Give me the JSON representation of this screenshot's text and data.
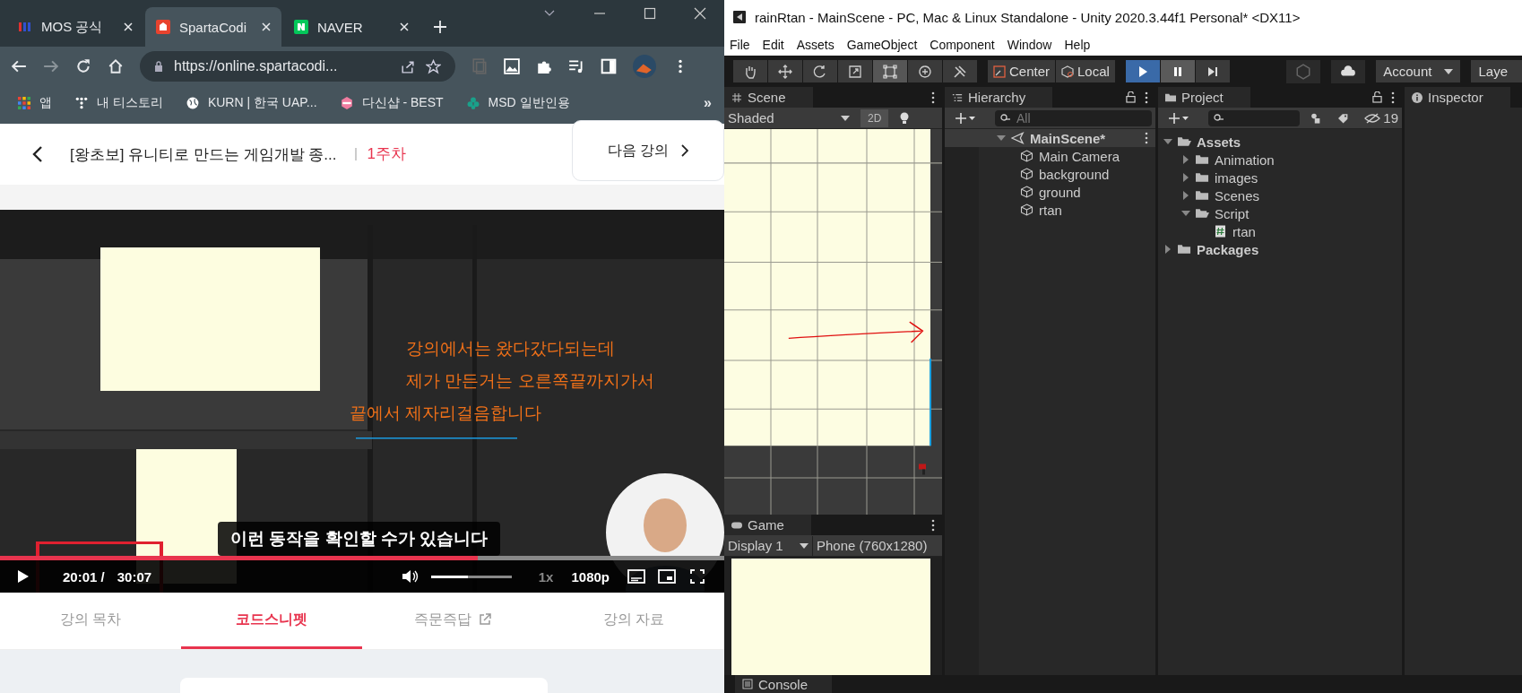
{
  "browser": {
    "tabs": [
      {
        "label": "MOS 공식",
        "selected": false
      },
      {
        "label": "SpartaCodi",
        "selected": true
      },
      {
        "label": "NAVER",
        "selected": false
      }
    ],
    "address": "https://online.spartacodi...",
    "bookmarks": [
      "앱",
      "내 티스토리",
      "KURN | 한국 UAP...",
      "다신샵 - BEST",
      "MSD 일반인용"
    ],
    "bookmarks_more": "»"
  },
  "course": {
    "title": "[왕초보] 유니티로 만드는 게임개발 종...",
    "week": "1주차",
    "next": "다음 강의"
  },
  "video": {
    "annotations": [
      "강의에서는 왔다갔다되는데",
      "제가 만든거는 오른쪽끝까지가서",
      "끝에서 제자리걸음합니다"
    ],
    "caption": "이런 동작을 확인할 수가 있습니다",
    "progress": {
      "level": 0.66
    },
    "current": "20:01 /",
    "total": "30:07",
    "volume": {
      "level": 0.46
    },
    "speed": "1x",
    "quality": "1080p"
  },
  "lecture_tabs": [
    {
      "label": "강의 목차",
      "selected": false,
      "external": false
    },
    {
      "label": "코드스니펫",
      "selected": true,
      "external": false
    },
    {
      "label": "즉문즉답",
      "selected": false,
      "external": true
    },
    {
      "label": "강의 자료",
      "selected": false,
      "external": false
    }
  ],
  "unity": {
    "title": "rainRtan - MainScene - PC, Mac & Linux Standalone - Unity 2020.3.44f1 Personal* <DX11>",
    "menu": [
      "File",
      "Edit",
      "Assets",
      "GameObject",
      "Component",
      "Window",
      "Help"
    ],
    "tools": [
      {
        "kind": "hand",
        "selected": false
      },
      {
        "kind": "move",
        "selected": false
      },
      {
        "kind": "rotate",
        "selected": false
      },
      {
        "kind": "scale",
        "selected": false
      },
      {
        "kind": "rect",
        "selected": true
      },
      {
        "kind": "transform",
        "selected": false
      },
      {
        "kind": "custom",
        "selected": false
      }
    ],
    "pivot": "Center",
    "space": "Local",
    "playback": [
      {
        "kind": "play",
        "on": true
      },
      {
        "kind": "pause",
        "on": true
      },
      {
        "kind": "step",
        "on": false
      }
    ],
    "account": "Account",
    "layers": "Laye",
    "scene": {
      "tab": "Scene",
      "shading": "Shaded",
      "mode": "2D"
    },
    "hierarchy": {
      "tab": "Hierarchy",
      "placeholder": "All",
      "tree": [
        {
          "label": "MainScene*",
          "kind": "scene",
          "expanded": true,
          "children": [
            {
              "label": "Main Camera",
              "kind": "object"
            },
            {
              "label": "background",
              "kind": "object"
            },
            {
              "label": "ground",
              "kind": "object"
            },
            {
              "label": "rtan",
              "kind": "object"
            }
          ]
        }
      ]
    },
    "project": {
      "tab": "Project",
      "hidden_count": "19",
      "tree": [
        {
          "label": "Assets",
          "kind": "folder",
          "expanded": true,
          "children": [
            {
              "label": "Animation",
              "kind": "folder",
              "expanded": false
            },
            {
              "label": "images",
              "kind": "folder",
              "expanded": false
            },
            {
              "label": "Scenes",
              "kind": "folder",
              "expanded": false
            },
            {
              "label": "Script",
              "kind": "folder",
              "expanded": true,
              "children": [
                {
                  "label": "rtan",
                  "kind": "script"
                }
              ]
            }
          ]
        },
        {
          "label": "Packages",
          "kind": "folder",
          "expanded": false
        }
      ]
    },
    "inspector": {
      "tab": "Inspector"
    },
    "game": {
      "tab": "Game",
      "display": "Display 1",
      "resolution": "Phone (760x1280)"
    },
    "console": {
      "tab": "Console"
    }
  }
}
